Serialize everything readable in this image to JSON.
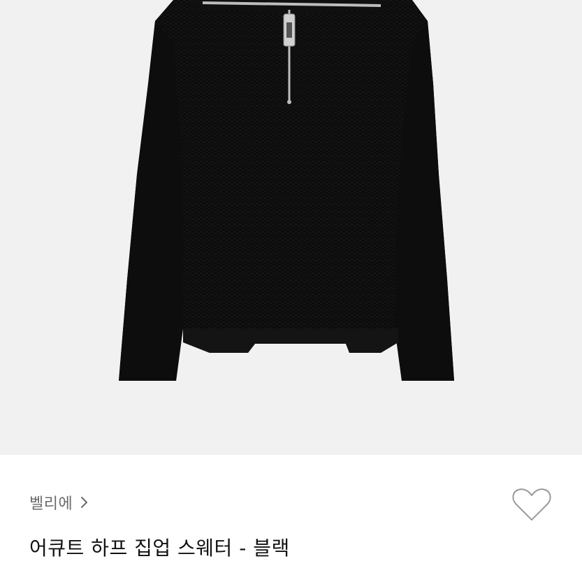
{
  "product": {
    "image_icon": "sweater-photo",
    "brand": "벨리에",
    "brand_chevron_icon": "chevron-right-icon",
    "title": "어큐트 하프 집업 스웨터 - 블랙",
    "like_icon": "heart-outline-icon"
  },
  "colors": {
    "image_background": "#f1f1f1",
    "sweater": "#0b0b0b",
    "zipper": "#bdbdbd",
    "brand_text": "#6a6a6a",
    "title_text": "#111111",
    "heart_stroke": "#9a9a9a"
  }
}
